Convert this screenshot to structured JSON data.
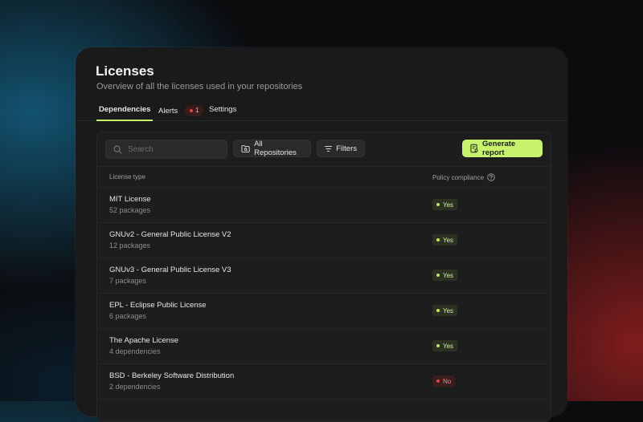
{
  "header": {
    "title": "Licenses",
    "subtitle": "Overview of all the licenses used in your repositories"
  },
  "tabs": [
    {
      "label": "Dependencies",
      "active": true
    },
    {
      "label": "Alerts",
      "badge": "1"
    },
    {
      "label": "Settings"
    }
  ],
  "toolbar": {
    "search_placeholder": "Search",
    "repos_label": "All Repositories",
    "filters_label": "Filters",
    "report_label": "Generate report"
  },
  "table": {
    "columns": [
      "License type",
      "Policy compliance"
    ],
    "rows": [
      {
        "name": "MIT License",
        "count": "52 packages",
        "compliance": "Yes",
        "status": "yes"
      },
      {
        "name": "GNUv2 - General Public License V2",
        "count": "12 packages",
        "compliance": "Yes",
        "status": "yes"
      },
      {
        "name": "GNUv3 - General Public License V3",
        "count": "7 packages",
        "compliance": "Yes",
        "status": "yes"
      },
      {
        "name": "EPL - Eclipse Public License",
        "count": "6 packages",
        "compliance": "Yes",
        "status": "yes"
      },
      {
        "name": "The Apache License",
        "count": "4 dependencies",
        "compliance": "Yes",
        "status": "yes"
      },
      {
        "name": "BSD - Berkeley Software Distribution",
        "count": "2 dependencies",
        "compliance": "No",
        "status": "no"
      }
    ]
  },
  "colors": {
    "accent": "#c6f36b",
    "yes": "#b8ea5c",
    "no": "#e04545",
    "panel": "#1a1a1a"
  },
  "icons": {
    "search": "search-icon",
    "repos": "folder-repo-icon",
    "filters": "filter-lines-icon",
    "report": "report-document-icon",
    "help": "help-circle-icon"
  }
}
